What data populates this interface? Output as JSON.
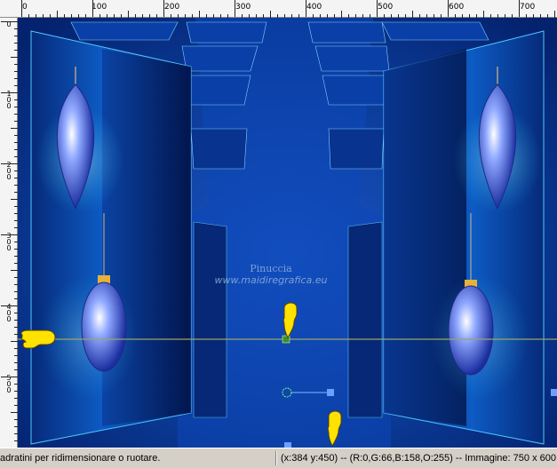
{
  "ruler": {
    "top_labels": [
      "0",
      "100",
      "200",
      "300",
      "400",
      "500",
      "600",
      "700"
    ],
    "left_labels": [
      "0",
      "100",
      "200",
      "300",
      "400",
      "500"
    ]
  },
  "watermark": {
    "line1": "Pinuccia",
    "line2": "www.maidiregrafica.eu"
  },
  "status": {
    "hint": "adratini per ridimensionare o ruotare.",
    "info": "(x:384 y:450) -- (R:0,G:66,B:158,O:255) -- Immagine:  750 x 600"
  },
  "colors": {
    "bg_blue": "#0b3a96",
    "dark_blue": "#041c63",
    "accent_cyan": "#2fd0ff",
    "guide_line": "#9aa36a"
  },
  "icons": [
    "pointing-hand-icon",
    "pointing-hand-icon",
    "pointing-hand-icon",
    "pointing-hand-icon",
    "rotation-handle-icon",
    "resize-handle-icon"
  ]
}
